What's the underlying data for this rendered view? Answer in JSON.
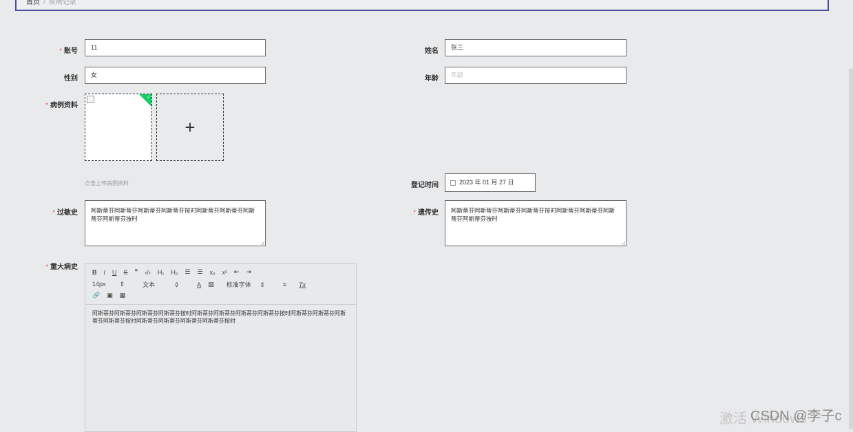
{
  "breadcrumb": {
    "home": "首页",
    "separator": "/",
    "current": "疾病记录"
  },
  "form": {
    "account": {
      "label": "账号",
      "value": "11"
    },
    "name": {
      "label": "姓名",
      "value": "张三"
    },
    "gender": {
      "label": "性别",
      "value": "女"
    },
    "age": {
      "label": "年龄",
      "placeholder": "年龄"
    },
    "case_images": {
      "label": "病例资料",
      "tip": "点击上传病例资料",
      "add_symbol": "+"
    },
    "register_date": {
      "label": "登记时间",
      "value": "2023 年 01 月 27 日"
    },
    "allergy": {
      "label": "过敏史",
      "value": "阿斯蒂芬阿斯蒂芬阿斯蒂芬阿斯蒂芬按时阿斯蒂芬阿斯蒂芬阿斯蒂芬阿斯蒂芬按时"
    },
    "genetic": {
      "label": "遗传史",
      "value": "阿斯蒂芬阿斯蒂芬阿斯蒂芬阿斯蒂芬按时阿斯蒂芬阿斯蒂芬阿斯蒂芬阿斯蒂芬按时"
    },
    "major_history": {
      "label": "重大病史",
      "content": "阿斯蒂芬阿斯蒂芬阿斯蒂芬阿斯蒂芬按时阿斯蒂芬阿斯蒂芬阿斯蒂芬阿斯蒂芬按时阿斯蒂芬阿斯蒂芬阿斯蒂芬阿斯蒂芬按时阿斯蒂芬阿斯蒂芬阿斯蒂芬阿斯蒂芬按时"
    }
  },
  "editor_toolbar": {
    "row1": [
      "B",
      "I",
      "U",
      "S",
      "❞",
      "‹/›",
      "H₁",
      "H₂",
      "☰",
      "☰",
      "x₂",
      "x²",
      "⇤",
      "⇥"
    ],
    "font_size": "14px",
    "block_type": "文本",
    "font_family": "标准字体",
    "color_glyph": "A",
    "bg_glyph": "▨",
    "align_glyph": "≡",
    "clear_glyph": "Tx",
    "select_arrow": "⇕",
    "row3": [
      "🔗",
      "▣",
      "▦"
    ]
  },
  "watermark": {
    "activate": "激活 Windows",
    "csdn": "CSDN @李子c"
  },
  "colors": {
    "required": "#e55555",
    "frame": "#4a4f9c",
    "upload_badge": "#13ce66"
  }
}
